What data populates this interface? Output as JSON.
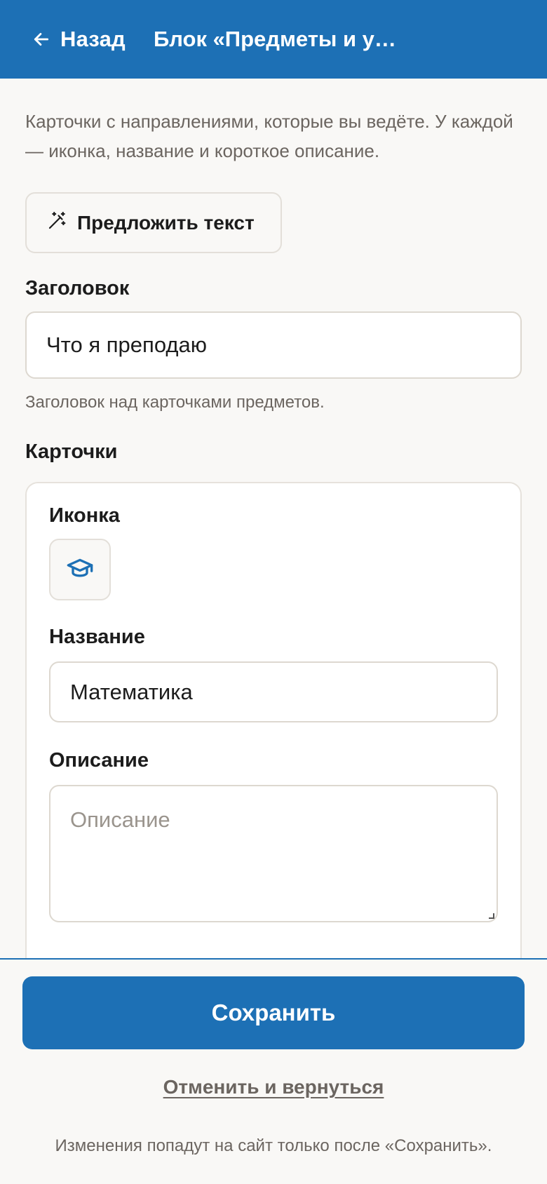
{
  "header": {
    "back_label": "Назад",
    "title": "Блок «Предметы и у…"
  },
  "intro_text": "Карточки с направлениями, которые вы ведёте. У каждой — иконка, название и короткое описание.",
  "suggest_button": {
    "label": "Предложить текст",
    "icon": "magic-wand-icon"
  },
  "heading_field": {
    "label": "Заголовок",
    "value": "Что я преподаю",
    "hint": "Заголовок над карточками предметов."
  },
  "cards_section": {
    "label": "Карточки",
    "card": {
      "icon_label": "Иконка",
      "icon": "graduation-cap-icon",
      "name_label": "Название",
      "name_value": "Математика",
      "description_label": "Описание",
      "description_placeholder": "Описание"
    }
  },
  "footer": {
    "save_label": "Сохранить",
    "cancel_label": "Отменить и вернуться",
    "note": "Изменения попадут на сайт только после «Сохранить»."
  },
  "colors": {
    "accent": "#1d70b5",
    "background": "#f9f8f6",
    "muted_text": "#6b6560"
  }
}
